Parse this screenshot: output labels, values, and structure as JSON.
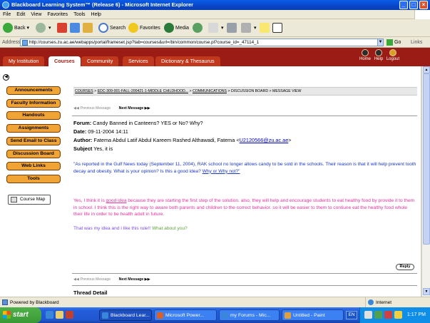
{
  "window": {
    "title": "Blackboard Learning System™ (Release 6) - Microsoft Internet Explorer"
  },
  "menu": [
    "File",
    "Edit",
    "View",
    "Favorites",
    "Tools",
    "Help"
  ],
  "toolbar": {
    "back": "Back",
    "search": "Search",
    "favorites": "Favorites",
    "media": "Media"
  },
  "address": {
    "label": "Address",
    "url": "http://courses.zu.ac.ae/webapps/portal/frameset.jsp?tab=courses&url=/bin/common/course.pl?course_id=_47114_1",
    "go": "Go",
    "links": "Links"
  },
  "bb_tabs": [
    "My Institution",
    "Courses",
    "Community",
    "Services",
    "Dictionary & Thesaurus"
  ],
  "bb_header_icons": {
    "home": "Home",
    "help": "Help",
    "logout": "Logout"
  },
  "course_nav": [
    "Announcements",
    "Faculty Information",
    "Handouts",
    "Assignments",
    "Send Email to Class",
    "Discussion Board",
    "Web Links",
    "Tools"
  ],
  "course_map": "Course Map",
  "breadcrumb": {
    "courses": "COURSES",
    "course": "EDC-309-001-FALL-200421-1-MIDDLE CHILDHOOD...",
    "communications": "COMMUNICATIONS",
    "rest": "DISCUSSION BOARD > MESSAGE VIEW",
    "sep": ">"
  },
  "message_nav": {
    "previous": "Previous Message",
    "next": "Next Message ▶▶",
    "prev_arrows": "◀◀"
  },
  "message": {
    "forum_label": "Forum:",
    "forum_value": "Candy Banned in Canteens? YES or No? Why?",
    "date_label": "Date:",
    "date_value": "09-11-2004 14:11",
    "author_label": "Author:",
    "author_value": "Fatema Abdul Latif Abdul Kareem Rashed Althawadi, Fatema <",
    "author_email": "U2120566@zu.ac.ae",
    "author_close": ">",
    "subject_label": "Subject",
    "subject_value": "Yes, it is",
    "quote_text": "\"As reported in the Gulf News today (September 11, 2004), RAK school no longer allows candy to be sold in the schools.  Their reason is that it will help prevent tooth decay and obesity.  What is your opinion?  Is this a good idea? ",
    "quote_link": "Why or Why not?\"",
    "reply_pre": "Yes, I think it is ",
    "reply_link": "good idea",
    "reply_post": "  because they are starting the first step of the solution. also, they will help and encourage students to eat healthy food by provide it to them in school. I think this is the right way to aware both parents and children to the correct behavior.  so it will be easier to them to contiune eat the healthy food whole their life in order to be health adult in future.",
    "closing_a": "That was my idea and i like this rule!! ",
    "closing_b": "What about you?"
  },
  "reply_button": "Reply",
  "thread_detail": "Thread Detail",
  "status": {
    "text": "Powered by Blackboard",
    "zone": "Internet"
  },
  "taskbar": {
    "start": "start",
    "tasks": [
      "Blackboard Lear...",
      "Microsoft Power...",
      "my Forums - Mic...",
      "Untitled - Paint"
    ],
    "lang": "EN",
    "clock": "1:17 PM"
  }
}
